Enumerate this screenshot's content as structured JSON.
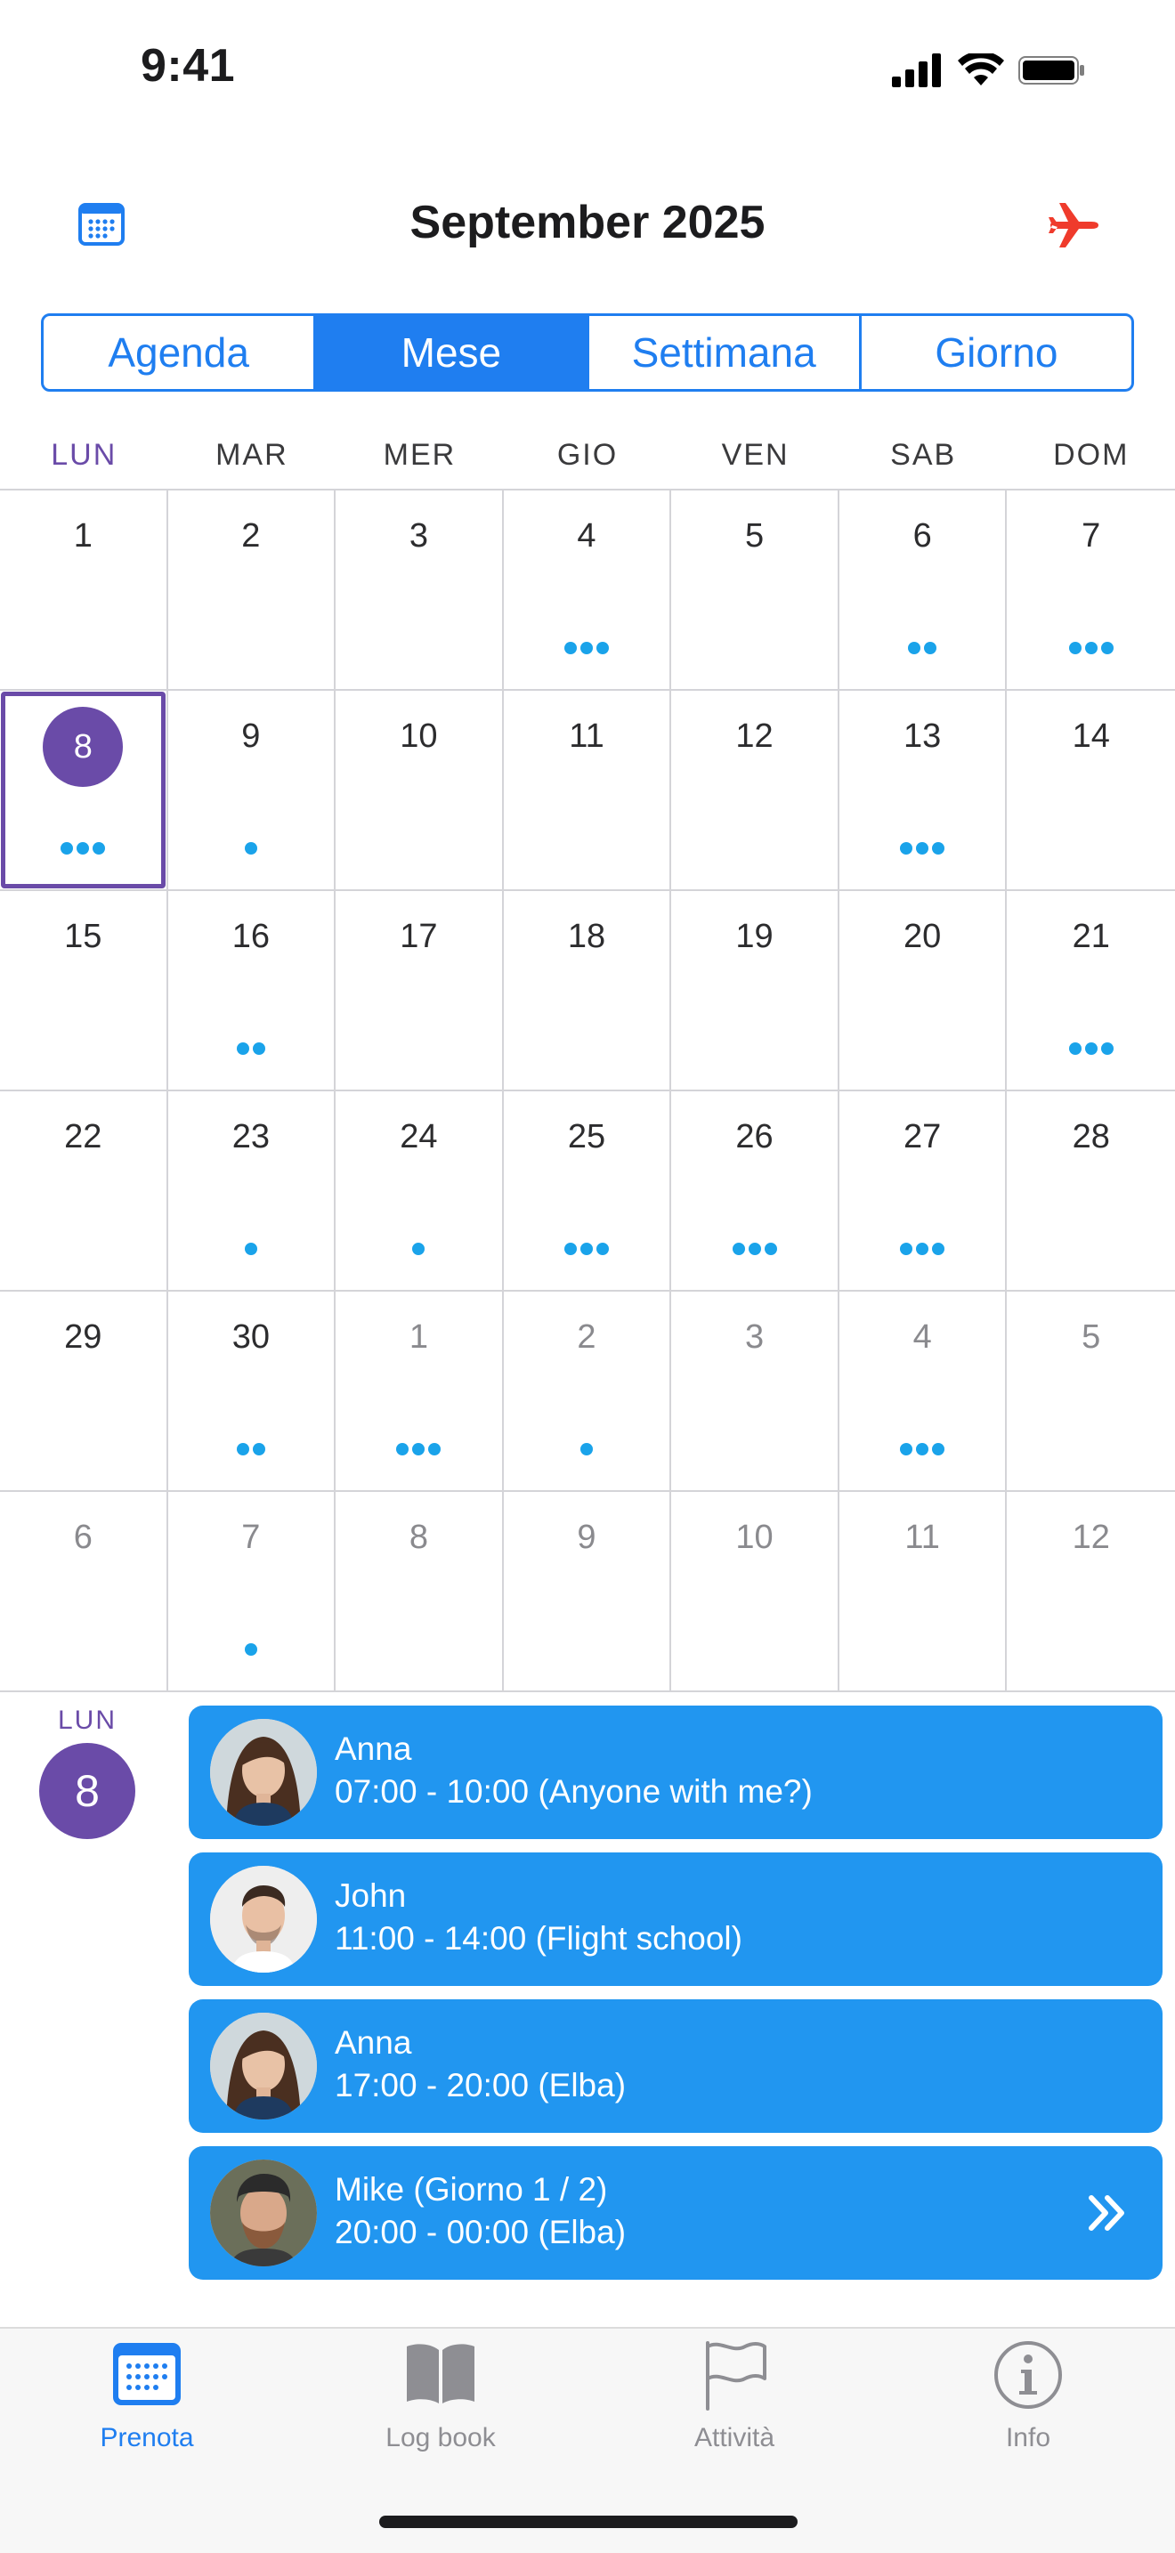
{
  "status_bar": {
    "time": "9:41"
  },
  "header": {
    "title": "September 2025",
    "left_icon": "calendar-icon",
    "right_icon": "airplane-icon",
    "accent": "#1f7ef0",
    "plane_color": "#ef3b2c"
  },
  "segmented": {
    "items": [
      "Agenda",
      "Mese",
      "Settimana",
      "Giorno"
    ],
    "selected": "Mese"
  },
  "weekdays": [
    "LUN",
    "MAR",
    "MER",
    "GIO",
    "VEN",
    "SAB",
    "DOM"
  ],
  "calendar": {
    "selected_day": "8",
    "selected_color": "#6a4ba8",
    "dot_color": "#1aa3ea",
    "days": [
      {
        "n": "1",
        "dots": 0,
        "cur": true
      },
      {
        "n": "2",
        "dots": 0,
        "cur": true
      },
      {
        "n": "3",
        "dots": 0,
        "cur": true
      },
      {
        "n": "4",
        "dots": 3,
        "cur": true
      },
      {
        "n": "5",
        "dots": 0,
        "cur": true
      },
      {
        "n": "6",
        "dots": 2,
        "cur": true
      },
      {
        "n": "7",
        "dots": 3,
        "cur": true
      },
      {
        "n": "8",
        "dots": 3,
        "cur": true,
        "selected": true
      },
      {
        "n": "9",
        "dots": 1,
        "cur": true
      },
      {
        "n": "10",
        "dots": 0,
        "cur": true
      },
      {
        "n": "11",
        "dots": 0,
        "cur": true
      },
      {
        "n": "12",
        "dots": 0,
        "cur": true
      },
      {
        "n": "13",
        "dots": 3,
        "cur": true
      },
      {
        "n": "14",
        "dots": 0,
        "cur": true
      },
      {
        "n": "15",
        "dots": 0,
        "cur": true
      },
      {
        "n": "16",
        "dots": 2,
        "cur": true
      },
      {
        "n": "17",
        "dots": 0,
        "cur": true
      },
      {
        "n": "18",
        "dots": 0,
        "cur": true
      },
      {
        "n": "19",
        "dots": 0,
        "cur": true
      },
      {
        "n": "20",
        "dots": 0,
        "cur": true
      },
      {
        "n": "21",
        "dots": 3,
        "cur": true
      },
      {
        "n": "22",
        "dots": 0,
        "cur": true
      },
      {
        "n": "23",
        "dots": 1,
        "cur": true
      },
      {
        "n": "24",
        "dots": 1,
        "cur": true
      },
      {
        "n": "25",
        "dots": 3,
        "cur": true
      },
      {
        "n": "26",
        "dots": 3,
        "cur": true
      },
      {
        "n": "27",
        "dots": 3,
        "cur": true
      },
      {
        "n": "28",
        "dots": 0,
        "cur": true
      },
      {
        "n": "29",
        "dots": 0,
        "cur": true
      },
      {
        "n": "30",
        "dots": 2,
        "cur": true
      },
      {
        "n": "1",
        "dots": 3,
        "cur": false
      },
      {
        "n": "2",
        "dots": 1,
        "cur": false
      },
      {
        "n": "3",
        "dots": 0,
        "cur": false
      },
      {
        "n": "4",
        "dots": 3,
        "cur": false
      },
      {
        "n": "5",
        "dots": 0,
        "cur": false
      },
      {
        "n": "6",
        "dots": 0,
        "cur": false
      },
      {
        "n": "7",
        "dots": 1,
        "cur": false
      },
      {
        "n": "8",
        "dots": 0,
        "cur": false
      },
      {
        "n": "9",
        "dots": 0,
        "cur": false
      },
      {
        "n": "10",
        "dots": 0,
        "cur": false
      },
      {
        "n": "11",
        "dots": 0,
        "cur": false
      },
      {
        "n": "12",
        "dots": 0,
        "cur": false
      }
    ]
  },
  "day_detail": {
    "weekday": "LUN",
    "day": "8",
    "events": [
      {
        "name": "Anna",
        "time": "07:00 - 10:00 (Anyone with me?)",
        "avatar": "anna"
      },
      {
        "name": "John",
        "time": "11:00 - 14:00 (Flight school)",
        "avatar": "john"
      },
      {
        "name": "Anna",
        "time": "17:00 - 20:00 (Elba)",
        "avatar": "anna"
      },
      {
        "name": "Mike (Giorno 1 / 2)",
        "time": "20:00 - 00:00 (Elba)",
        "avatar": "mike",
        "continues": true
      }
    ],
    "event_color": "#2196f0"
  },
  "tab_bar": {
    "tabs": [
      {
        "label": "Prenota",
        "icon": "calendar-grid-icon",
        "active": true
      },
      {
        "label": "Log book",
        "icon": "book-icon",
        "active": false
      },
      {
        "label": "Attività",
        "icon": "flag-icon",
        "active": false
      },
      {
        "label": "Info",
        "icon": "info-icon",
        "active": false
      }
    ]
  }
}
